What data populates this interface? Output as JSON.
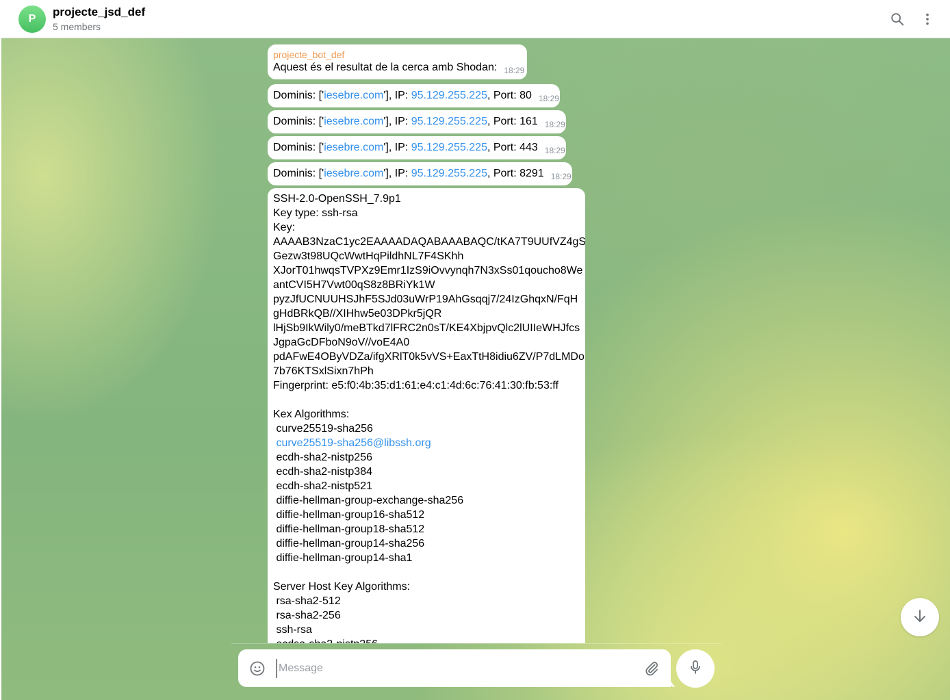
{
  "header": {
    "avatar_letter": "P",
    "title": "projecte_jsd_def",
    "subtitle": "5 members",
    "search_icon": "search-icon",
    "menu_icon": "more-vertical-icon"
  },
  "messages": {
    "first": {
      "sender": "projecte_bot_def",
      "text": "Aquest és el resultat de la cerca amb Shodan:",
      "time": "18:29"
    },
    "domains": [
      {
        "pre": "Dominis: ['",
        "domain": "iesebre.com",
        "mid": "'], IP: ",
        "ip": "95.129.255.225",
        "port": ", Port: 80",
        "time": "18:29"
      },
      {
        "pre": "Dominis: ['",
        "domain": "iesebre.com",
        "mid": "'], IP: ",
        "ip": "95.129.255.225",
        "port": ", Port: 161",
        "time": "18:29"
      },
      {
        "pre": "Dominis: ['",
        "domain": "iesebre.com",
        "mid": "'], IP: ",
        "ip": "95.129.255.225",
        "port": ", Port: 443",
        "time": "18:29"
      },
      {
        "pre": "Dominis: ['",
        "domain": "iesebre.com",
        "mid": "'], IP: ",
        "ip": "95.129.255.225",
        "port": ", Port: 8291",
        "time": "18:29"
      }
    ],
    "ssh": {
      "lines_a": "SSH-2.0-OpenSSH_7.9p1\nKey type: ssh-rsa\nKey:\nAAAAB3NzaC1yc2EAAAADAQABAAABAQC/tKA7T9UUfVZ4gS\nGezw3t98UQcWwtHqPildhNL7F4SKhh\nXJorT01hwqsTVPXz9Emr1IzS9iOvvynqh7N3xSs01qoucho8We\nantCVI5H7Vwt00qS8z8BRiYk1W\npyzJfUCNUUHSJhF5SJd03uWrP19AhGsqqj7/24IzGhqxN/FqH\ngHdBRkQB//XIHhw5e03DPkr5jQR\nlHjSb9IkWily0/meBTkd7lFRC2n0sT/KE4XbjpvQlc2lUIIeWHJfcs\nJgpaGcDFboN9oV//voE4A0\npdAFwE4OByVDZa/ifgXRlT0k5vVS+EaxTtH8idiu6ZV/P7dLMDo\n7b76KTSxlSixn7hPh\nFingerprint: e5:f0:4b:35:d1:61:e4:c1:4d:6c:76:41:30:fb:53:ff\n\nKex Algorithms:\n curve25519-sha256\n ",
      "link": "curve25519-sha256@libssh.org",
      "lines_b": "\n ecdh-sha2-nistp256\n ecdh-sha2-nistp384\n ecdh-sha2-nistp521\n diffie-hellman-group-exchange-sha256\n diffie-hellman-group16-sha512\n diffie-hellman-group18-sha512\n diffie-hellman-group14-sha256\n diffie-hellman-group14-sha1\n\nServer Host Key Algorithms:\n rsa-sha2-512\n rsa-sha2-256\n ssh-rsa\n ecdsa-sha2-nistp256"
    }
  },
  "composer": {
    "placeholder": "Message",
    "emoji_icon": "smile-icon",
    "attach_icon": "paperclip-icon",
    "mic_icon": "microphone-icon",
    "scroll_icon": "arrow-down-icon"
  },
  "colors": {
    "link": "#3390ec",
    "sender": "#f09a50",
    "avatar": "#4fc46a"
  }
}
